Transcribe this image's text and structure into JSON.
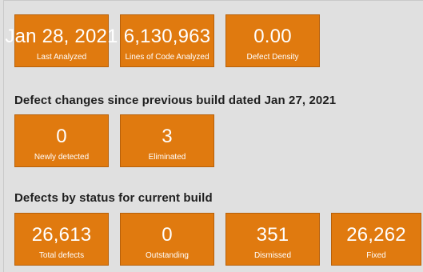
{
  "summary": {
    "tiles": [
      {
        "value": "Jan 28, 2021",
        "label": "Last Analyzed"
      },
      {
        "value": "6,130,963",
        "label": "Lines of Code Analyzed"
      },
      {
        "value": "0.00",
        "label": "Defect Density"
      }
    ]
  },
  "changes": {
    "heading": "Defect changes since previous build dated Jan 27, 2021",
    "tiles": [
      {
        "value": "0",
        "label": "Newly detected"
      },
      {
        "value": "3",
        "label": "Eliminated"
      }
    ]
  },
  "status": {
    "heading": "Defects by status for current build",
    "tiles": [
      {
        "value": "26,613",
        "label": "Total defects"
      },
      {
        "value": "0",
        "label": "Outstanding"
      },
      {
        "value": "351",
        "label": "Dismissed"
      },
      {
        "value": "26,262",
        "label": "Fixed"
      }
    ]
  },
  "colors": {
    "tile_background": "#e07a0f",
    "tile_text": "#ffffff",
    "page_background": "#e0e0e0"
  }
}
